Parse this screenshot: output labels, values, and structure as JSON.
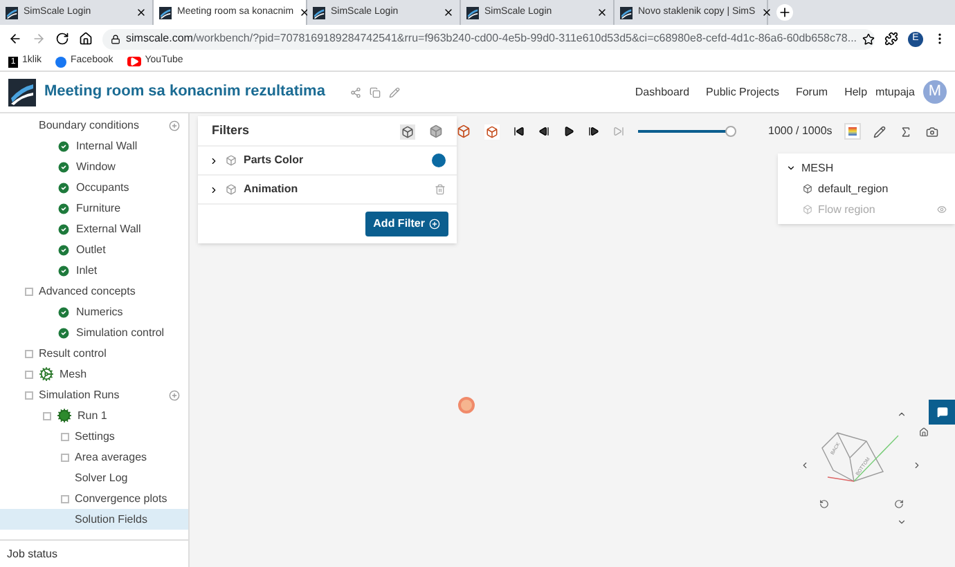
{
  "browser": {
    "tabs": [
      {
        "title": "SimScale Login",
        "selected": false
      },
      {
        "title": "Meeting room sa konacnim",
        "selected": true
      },
      {
        "title": "SimScale Login",
        "selected": false
      },
      {
        "title": "SimScale Login",
        "selected": false
      },
      {
        "title": "Novo staklenik copy | SimS",
        "selected": false
      }
    ],
    "url_host": "simscale.com",
    "url_path": "/workbench/?pid=7078169189284742541&rru=f963b240-cd00-4e5b-99d0-311e610d53d5&ci=c68980e8-cefd-4d1c-86a6-60db658c78...",
    "profile_initial": "E",
    "bookmarks": [
      {
        "label": "1klik",
        "kind": "number",
        "icon": "1"
      },
      {
        "label": "Facebook",
        "kind": "facebook"
      },
      {
        "label": "YouTube",
        "kind": "youtube"
      }
    ]
  },
  "header": {
    "project_title": "Meeting room sa konacnim rezultatima",
    "nav": [
      "Dashboard",
      "Public Projects",
      "Forum",
      "Help"
    ],
    "username": "mtupaja",
    "avatar_initial": "M"
  },
  "tree": [
    {
      "label": "Boundary conditions",
      "toggle": false,
      "add": true,
      "children": [
        {
          "label": "Internal Wall",
          "kind": "check"
        },
        {
          "label": "Window",
          "kind": "check"
        },
        {
          "label": "Occupants",
          "kind": "check"
        },
        {
          "label": "Furniture",
          "kind": "check"
        },
        {
          "label": "External Wall",
          "kind": "check"
        },
        {
          "label": "Outlet",
          "kind": "check"
        },
        {
          "label": "Inlet",
          "kind": "check"
        }
      ]
    },
    {
      "label": "Advanced concepts",
      "toggle": true,
      "children": [
        {
          "label": "Numerics",
          "kind": "check"
        },
        {
          "label": "Simulation control",
          "kind": "check"
        }
      ]
    },
    {
      "label": "Result control",
      "toggle": true
    },
    {
      "label": "Mesh",
      "toggle": true,
      "kind": "mesh"
    },
    {
      "label": "Simulation Runs",
      "toggle": true,
      "add": true,
      "children": [
        {
          "label": "Run 1",
          "toggle": true,
          "kind": "run",
          "children": [
            {
              "label": "Settings",
              "toggle": true,
              "selected": false
            },
            {
              "label": "Area averages",
              "toggle": true,
              "selected": false
            },
            {
              "label": "Solver Log",
              "toggle": false,
              "selected": false
            },
            {
              "label": "Convergence plots",
              "toggle": true,
              "selected": false
            },
            {
              "label": "Solution Fields",
              "toggle": false,
              "selected": true
            }
          ]
        }
      ]
    }
  ],
  "job_status": "Job status",
  "filters": {
    "title": "Filters",
    "items": [
      {
        "label": "Parts Color",
        "kind": "toggle",
        "on": true
      },
      {
        "label": "Animation",
        "kind": "delete"
      }
    ],
    "add_button": "Add Filter"
  },
  "player": {
    "level": 0.95,
    "reading": "1000 / 1000s"
  },
  "mesh_panel": {
    "title": "MESH",
    "items": [
      {
        "label": "default_region",
        "disabled": false
      },
      {
        "label": "Flow region",
        "disabled": true
      }
    ]
  },
  "view_cube": {
    "faces": [
      "BACK",
      "BOTTOM"
    ]
  }
}
